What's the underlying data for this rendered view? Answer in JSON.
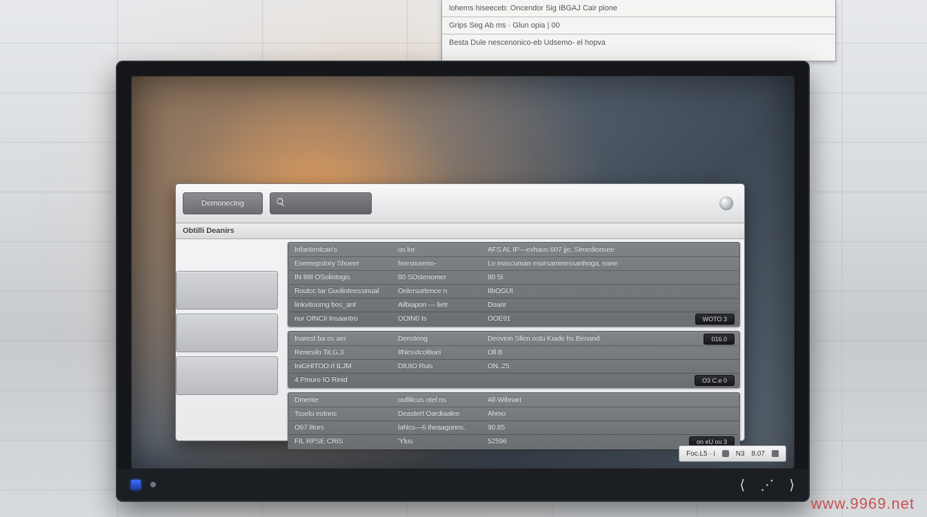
{
  "watermark": "www.9969.net",
  "top_note": {
    "line1": "lohems hiseeceb: Oncendor Sig IBGAJ Cair pione",
    "line2": "Grips Seg Ab ms · Glun opia | 00",
    "line3": "Besta Dule nescenonico-eb Udsemo- el hopva"
  },
  "app": {
    "tab_label": "Demonecing",
    "search_placeholder": "",
    "section_title": "Obtilli Deanirs",
    "sidebar": {
      "items": [
        "",
        "",
        ""
      ]
    },
    "groups": [
      {
        "rows": [
          {
            "c1": "Infantentcan's",
            "c2": "us lor-",
            "c3": "AFS AL  IP—exhaus 607 jje, Simedionsee"
          },
          {
            "c1": "Enemepstory Shoeer",
            "c2": "hvesnureno-",
            "c3": "Lo mascuman esursaminessanhoga, eane"
          },
          {
            "c1": "IN  IIIII  OSolintogis",
            "c2": "80 SOstenomer",
            "c3": "80 5I"
          },
          {
            "c1": "Routcc tar   Guolinteessinual",
            "c2": "Onlersurtence n",
            "c3": "IIbOGUI"
          },
          {
            "c1": "linkvitourng bos_ant",
            "c2": "Ailbiapon — lietr",
            "c3": "Doanr",
            "badge": ""
          },
          {
            "c1": "nur OINCIi  Insaantro",
            "c2": "OOIN0 Is",
            "c3": "OOE91",
            "badge": "WOTO 3"
          }
        ]
      },
      {
        "rows": [
          {
            "c1": "Inarest ba os aer",
            "c2": "Densteng",
            "c3": "Deovion Sllen.ostu   Kiade                 hs Benand",
            "badge": "016.0"
          },
          {
            "c1": "Renesilo  TiLG.3",
            "c2": "IINesxtcoltiuei",
            "c3": "Oll B"
          },
          {
            "c1": "IniGHITOO:rl ILJM",
            "c2": "DIUIO Ruis",
            "c3": "ON..25"
          },
          {
            "c1": "4 Pmuro IO Rinid",
            "c2": "",
            "c3": "",
            "badge": "O3 C.e  0"
          }
        ]
      },
      {
        "rows": [
          {
            "c1": "Dmente",
            "c2": "uullilicus otel ns",
            "c3": "All-Wibnart"
          },
          {
            "c1": "Tsselu eutnns",
            "c2": "Deastert  Oardiaalee",
            "c3": "Ahmo"
          },
          {
            "c1": "O67 litors",
            "c2": "laNcs—6 iheaagonns.",
            "c3": "90.85"
          },
          {
            "c1": "FIL RPSE CRiS",
            "c2": "'Ylus",
            "c3": "52596",
            "badge": "on  eU ou 3"
          }
        ]
      }
    ]
  },
  "tray": {
    "items": [
      "Foc.L5 · i",
      "",
      "N3",
      "8.07",
      ""
    ]
  }
}
